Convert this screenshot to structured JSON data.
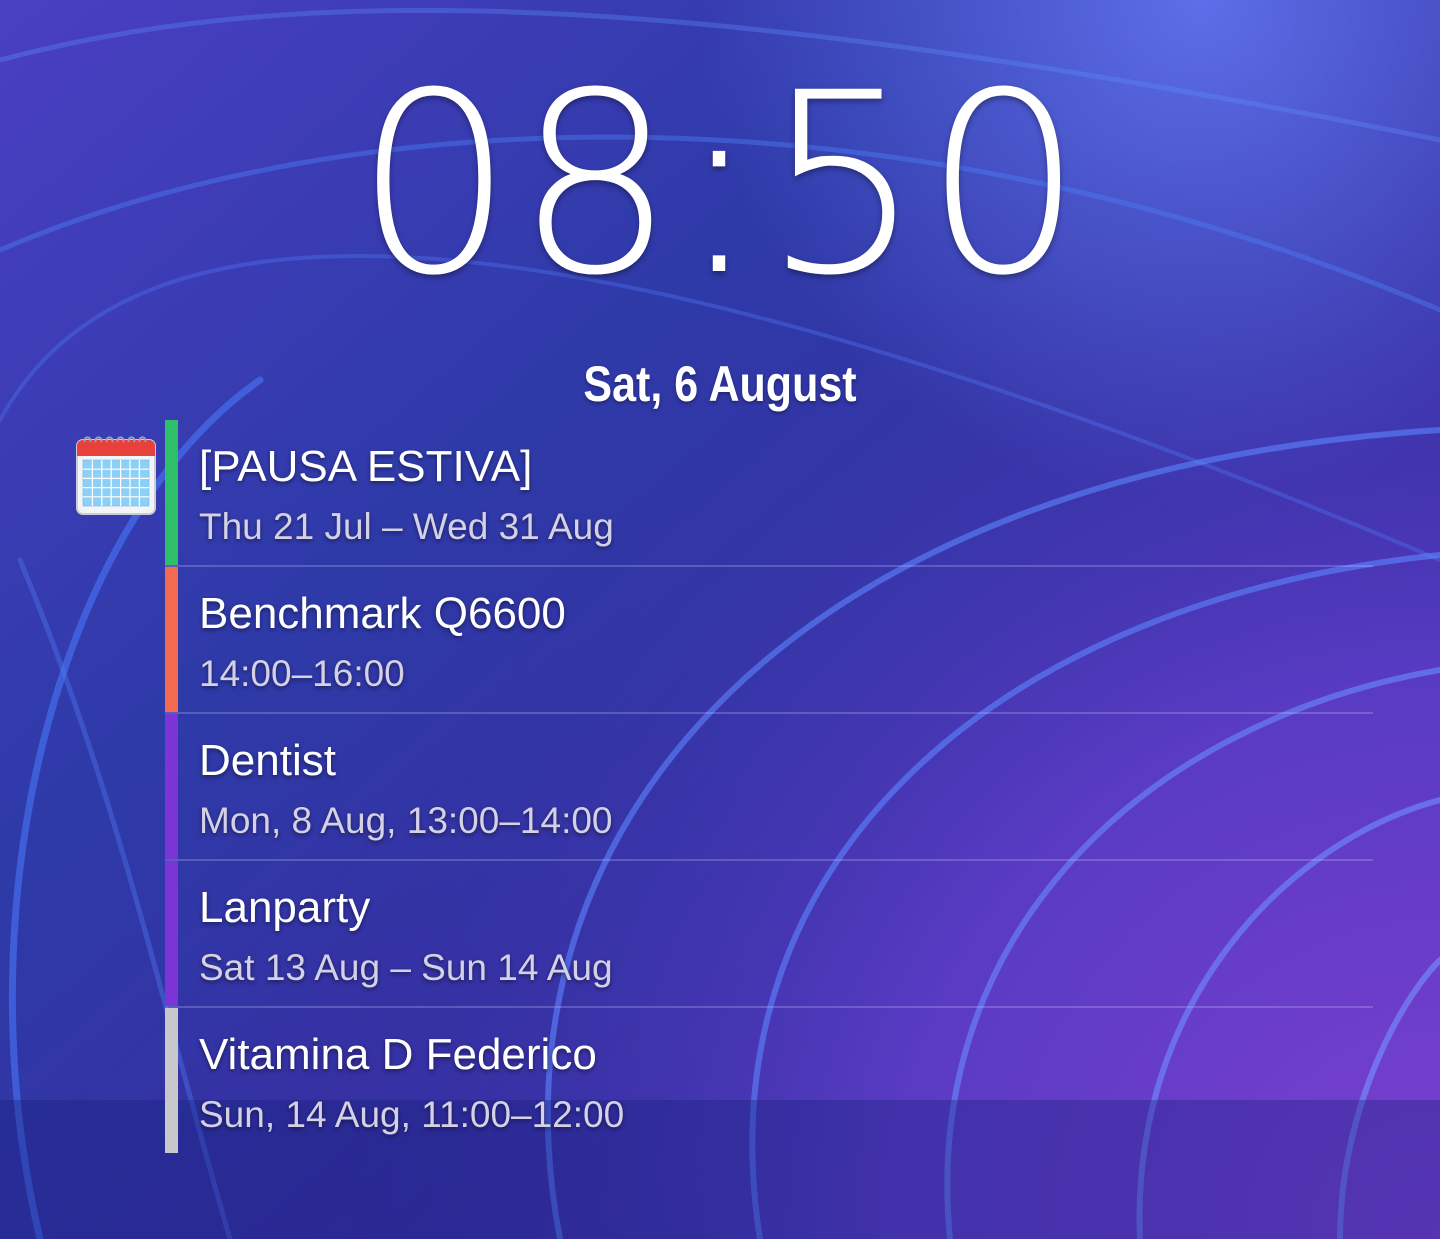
{
  "clock": {
    "time": "08:50"
  },
  "date": {
    "label": "Sat, 6 August"
  },
  "calendar_icon": "calendar-icon",
  "events": [
    {
      "title": "[PAUSA ESTIVA]",
      "when": "Thu 21 Jul – Wed 31 Aug",
      "color": "#2fbf6b"
    },
    {
      "title": "Benchmark Q6600",
      "when": "14:00–16:00",
      "color": "#f26b4f"
    },
    {
      "title": "Dentist",
      "when": "Mon, 8 Aug, 13:00–14:00",
      "color": "#7b35d6"
    },
    {
      "title": "Lanparty",
      "when": "Sat 13 Aug – Sun 14 Aug",
      "color": "#7b35d6"
    },
    {
      "title": "Vitamina D Federico",
      "when": "Sun, 14 Aug, 11:00–12:00",
      "color": "#c8c8cc"
    }
  ]
}
